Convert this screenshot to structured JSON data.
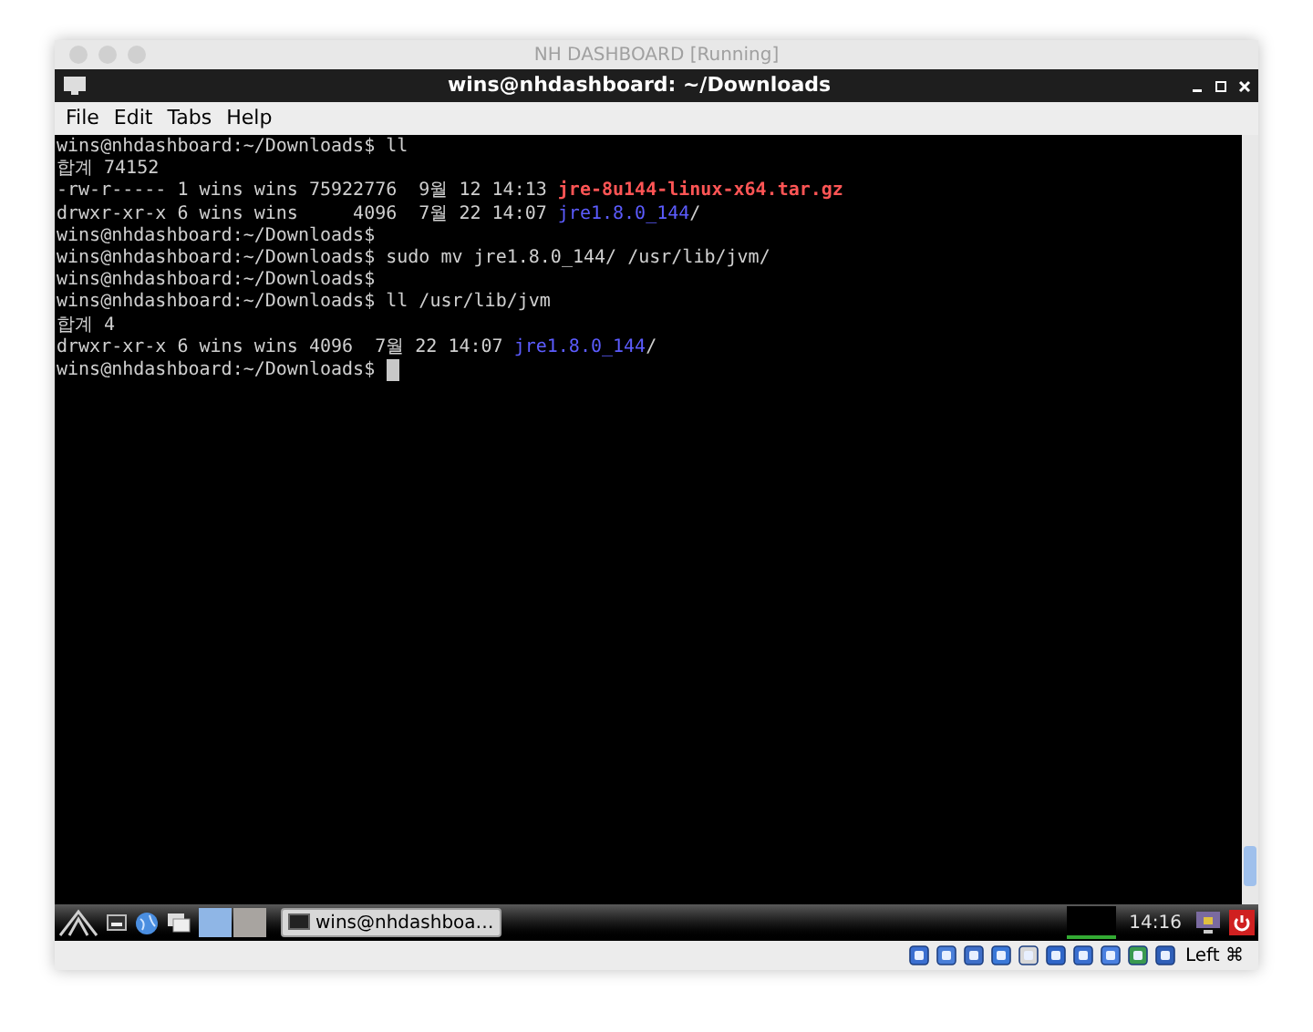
{
  "host_window": {
    "title": "NH DASHBOARD [Running]"
  },
  "window": {
    "title": "wins@nhdashboard: ~/Downloads"
  },
  "menu": [
    "File",
    "Edit",
    "Tabs",
    "Help"
  ],
  "terminal": {
    "lines": [
      [
        {
          "text": "wins@nhdashboard:~/Downloads$ ll",
          "kind": "plain"
        }
      ],
      [
        {
          "text": "합계 74152",
          "kind": "plain"
        }
      ],
      [
        {
          "text": "-rw-r----- 1 wins wins 75922776  9월 12 14:13 ",
          "kind": "plain"
        },
        {
          "text": "jre-8u144-linux-x64.tar.gz",
          "kind": "archive"
        }
      ],
      [
        {
          "text": "drwxr-xr-x 6 wins wins     4096  7월 22 14:07 ",
          "kind": "plain"
        },
        {
          "text": "jre1.8.0_144",
          "kind": "dir"
        },
        {
          "text": "/",
          "kind": "plain"
        }
      ],
      [
        {
          "text": "wins@nhdashboard:~/Downloads$",
          "kind": "plain"
        }
      ],
      [
        {
          "text": "wins@nhdashboard:~/Downloads$ sudo mv jre1.8.0_144/ /usr/lib/jvm/",
          "kind": "plain"
        }
      ],
      [
        {
          "text": "wins@nhdashboard:~/Downloads$",
          "kind": "plain"
        }
      ],
      [
        {
          "text": "wins@nhdashboard:~/Downloads$ ll /usr/lib/jvm",
          "kind": "plain"
        }
      ],
      [
        {
          "text": "합계 4",
          "kind": "plain"
        }
      ],
      [
        {
          "text": "drwxr-xr-x 6 wins wins 4096  7월 22 14:07 ",
          "kind": "plain"
        },
        {
          "text": "jre1.8.0_144",
          "kind": "dir"
        },
        {
          "text": "/",
          "kind": "plain"
        }
      ],
      [
        {
          "text": "wins@nhdashboard:~/Downloads$ ",
          "kind": "plain"
        },
        {
          "kind": "cursor"
        }
      ]
    ]
  },
  "taskbar": {
    "workspaces": [
      {
        "selected": true
      },
      {
        "selected": false
      }
    ],
    "task": "wins@nhdashboa…",
    "clock": "14:16"
  },
  "status_bar": {
    "host_key": "Left ⌘"
  }
}
